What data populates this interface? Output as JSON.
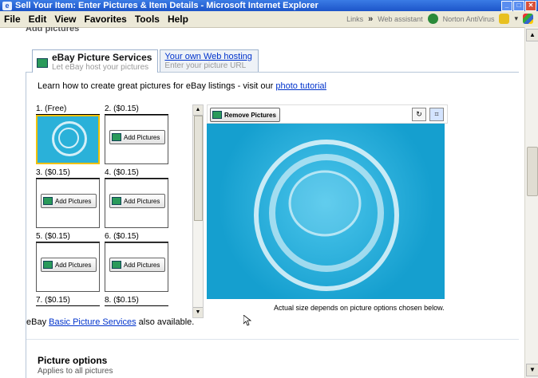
{
  "window": {
    "title": "Sell Your Item: Enter Pictures & Item Details - Microsoft Internet Explorer"
  },
  "menu": {
    "items": [
      "File",
      "Edit",
      "View",
      "Favorites",
      "Tools",
      "Help"
    ],
    "links_label": "Links",
    "chevron": "»",
    "web_assistant": "Web assistant",
    "norton": "Norton AntiVirus"
  },
  "section_cut": "Add pictures",
  "tabs": [
    {
      "title": "eBay Picture Services",
      "subtitle": "Let eBay host your pictures"
    },
    {
      "title": "Your own Web hosting",
      "subtitle": "Enter your picture URL"
    }
  ],
  "learn": {
    "text": "Learn how to create great pictures for eBay listings - visit our ",
    "link": "photo tutorial"
  },
  "picture_slots": [
    {
      "label": "1. (Free)",
      "has_image": true
    },
    {
      "label": "2. ($0.15)",
      "button": "Add Pictures"
    },
    {
      "label": "3. ($0.15)",
      "button": "Add Pictures"
    },
    {
      "label": "4. ($0.15)",
      "button": "Add Pictures"
    },
    {
      "label": "5. ($0.15)",
      "button": "Add Pictures"
    },
    {
      "label": "6. ($0.15)",
      "button": "Add Pictures"
    },
    {
      "label": "7. ($0.15)"
    },
    {
      "label": "8. ($0.15)"
    }
  ],
  "preview": {
    "remove_button": "Remove Pictures",
    "caption": "Actual size depends on picture options chosen below."
  },
  "basic": {
    "prefix": "eBay ",
    "link": "Basic Picture Services",
    "suffix": " also available."
  },
  "picture_options": {
    "title": "Picture options",
    "subtitle": "Applies to all pictures"
  }
}
